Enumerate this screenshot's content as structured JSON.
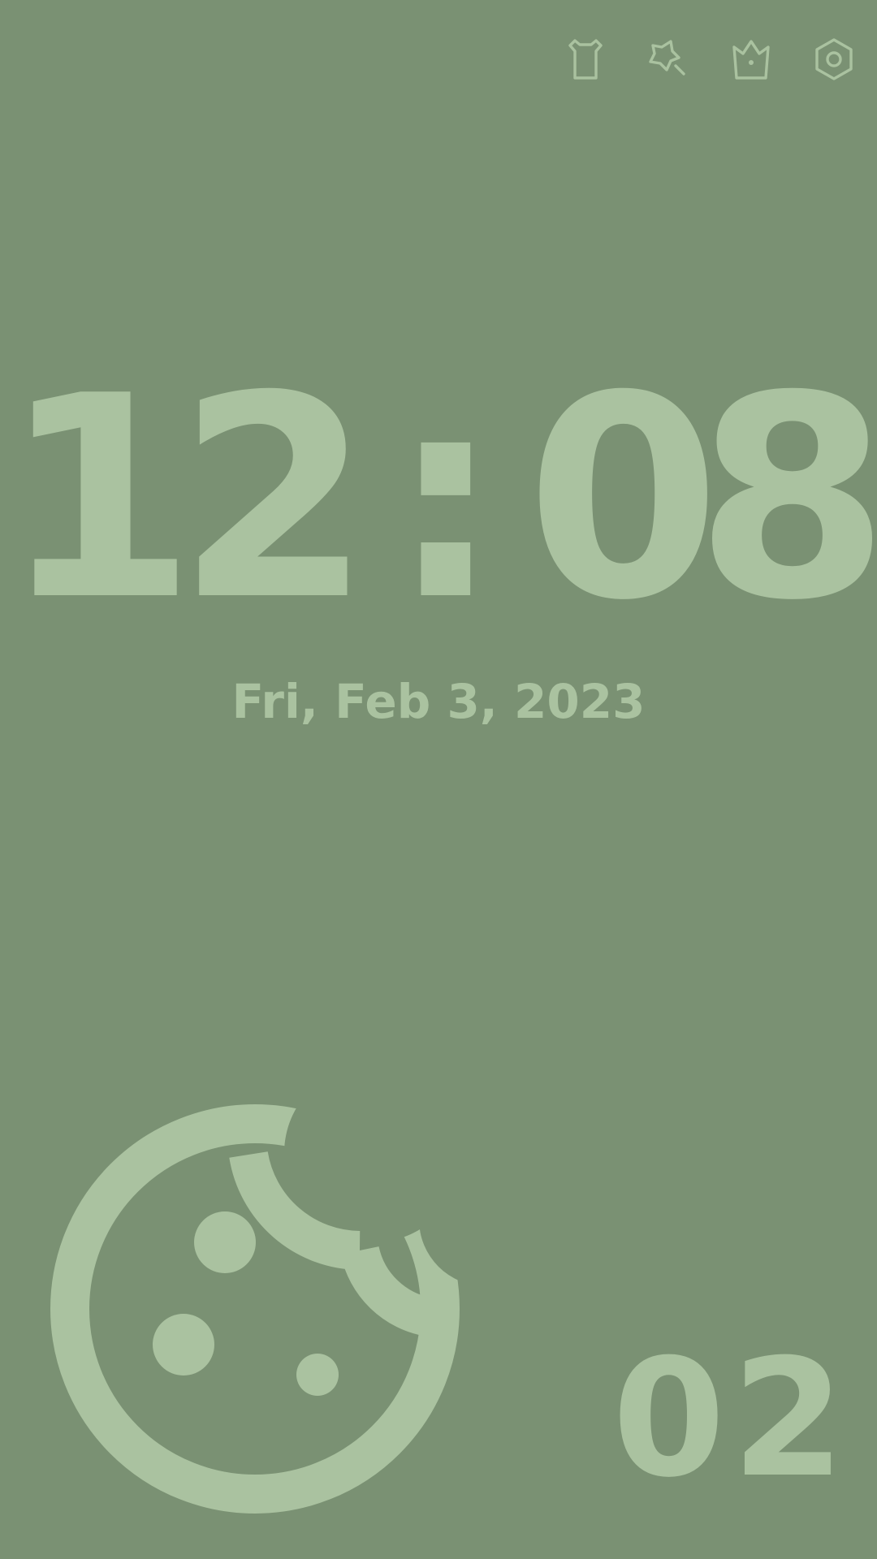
{
  "toolbar": {
    "icons": [
      "shirt-icon",
      "sparkle-icon",
      "crown-icon",
      "settings-icon"
    ]
  },
  "clock": {
    "hour_tens": "1",
    "hour_ones": "2",
    "separator": ":",
    "minute_tens": "0",
    "minute_ones": "8"
  },
  "date": "Fri, Feb 3, 2023",
  "cookie": {
    "icon": "cookie-icon"
  },
  "counter": "02",
  "colors": {
    "background": "#7a9173",
    "foreground": "#aac2a0"
  }
}
